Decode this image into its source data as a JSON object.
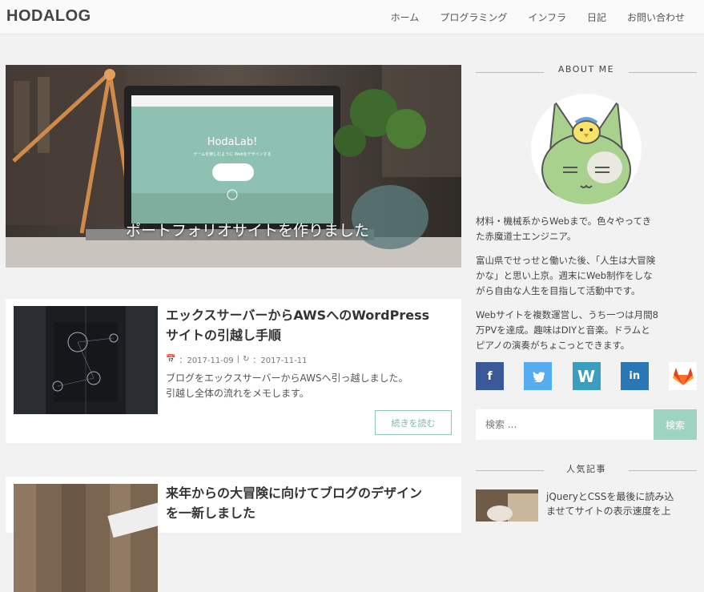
{
  "header": {
    "logo": "HODALOG",
    "nav": [
      "ホーム",
      "プログラミング",
      "インフラ",
      "日記",
      "お問い合わせ"
    ]
  },
  "slider": {
    "caption": "ポートフォリオサイトを作りました",
    "screen_title": "HodaLab!",
    "screen_sub": "ゲームを楽しむように Webをデザインする",
    "dots": 3,
    "active_dot": 1
  },
  "posts": [
    {
      "title_line1": "エックスサーバーからAWSへのWordPress",
      "title_line2": "サイトの引越し手順",
      "published": "：2017-11-09",
      "sep": "|",
      "updated": "：2017-11-11",
      "excerpt_line1": "ブログをエックスサーバーからAWSへ引っ越しました。",
      "excerpt_line2": "引越し全体の流れをメモします。",
      "more": "続きを読む"
    },
    {
      "title_line1": "来年からの大冒険に向けてブログのデザイン",
      "title_line2": "を一新しました"
    }
  ],
  "sidebar": {
    "about_heading": "ABOUT ME",
    "about_p1_l1": "材料・機械系からWebまで。色々やってき",
    "about_p1_l2": "た赤魔道士エンジニア。",
    "about_p2_l1": "富山県でせっせと働いた後、「人生は大冒険",
    "about_p2_l2": "かな」と思い上京。週末にWeb制作をしな",
    "about_p2_l3": "がら自由な人生を目指して活動中です。",
    "about_p3_l1": "Webサイトを複数運営し、うち一つは月間8",
    "about_p3_l2": "万PVを達成。趣味はDIYと音楽。ドラムと",
    "about_p3_l3": "ピアノの演奏がちょこっとできます。",
    "social": [
      {
        "name": "facebook-icon",
        "glyph": "f",
        "color": "#3b5998"
      },
      {
        "name": "twitter-icon",
        "glyph": "🐦",
        "color": "#55acee"
      },
      {
        "name": "wordpress-icon",
        "glyph": "W",
        "color": "#3a9fbf"
      },
      {
        "name": "linkedin-icon",
        "glyph": "in",
        "color": "#2a77b5"
      },
      {
        "name": "gitlab-icon",
        "glyph": "",
        "color": "#ffffff"
      }
    ],
    "search_placeholder": "検索 ...",
    "search_button": "検索",
    "popular_heading": "人気記事",
    "popular_l1": "jQueryとCSSを最後に読み込",
    "popular_l2": "ませてサイトの表示速度を上"
  },
  "colors": {
    "accent": "#9fd3c2",
    "button_border": "#8cc4b5"
  }
}
